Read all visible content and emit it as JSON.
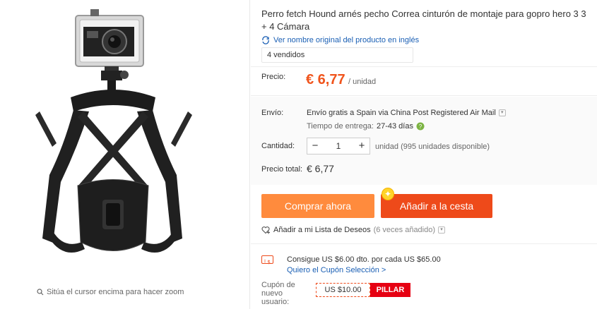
{
  "product": {
    "title": "Perro fetch Hound arnés pecho Correa cinturón de montaje para gopro hero 3 3 + 4 Cámara",
    "translate_link": "Ver nombre original del producto en inglés",
    "sold": "4 vendidos",
    "zoom_hint": "Sitúa el cursor encima para hacer zoom"
  },
  "price": {
    "label": "Precio:",
    "value": "€ 6,77",
    "unit": "/ unidad"
  },
  "shipping": {
    "label": "Envío:",
    "text": "Envío gratis a Spain via China Post Registered Air Mail",
    "delivery_label": "Tiempo de entrega:",
    "delivery_value": "27-43 días"
  },
  "quantity": {
    "label": "Cantidad:",
    "minus": "−",
    "value": "1",
    "plus": "+",
    "info": "unidad (995 unidades disponible)"
  },
  "total": {
    "label": "Precio total:",
    "value": "€ 6,77"
  },
  "actions": {
    "buy_now": "Comprar ahora",
    "add_to_cart": "Añadir a la cesta",
    "wishlist": "Añadir a mi Lista de Deseos",
    "wishlist_count": "(6 veces añadido)"
  },
  "coupon": {
    "text": "Consigue US $6.00 dto. por cada US $65.00",
    "link": "Quiero el Cupón Selección >",
    "new_user_label": "Cupón de nuevo usuario:",
    "value": "US $10.00",
    "grab": "PILLAR"
  },
  "colors": {
    "accent_orange": "#ff8b3d",
    "accent_red": "#ee4a1a",
    "price": "#f0541c",
    "link": "#1a5fb4"
  }
}
